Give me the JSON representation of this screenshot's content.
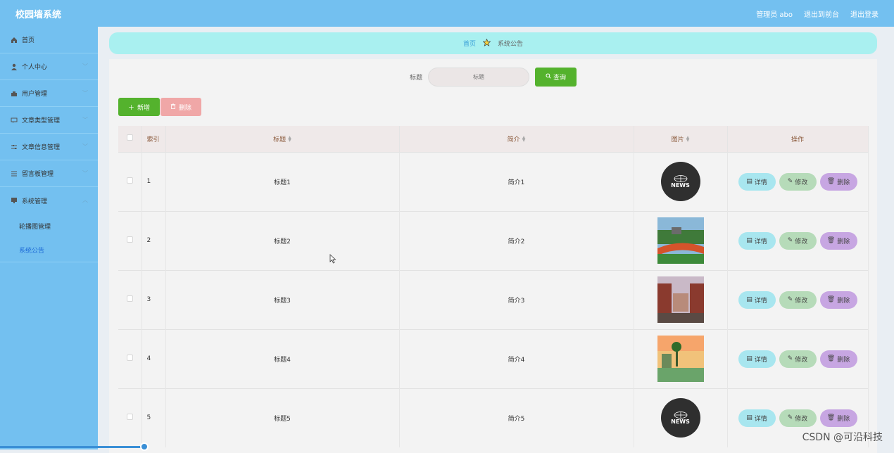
{
  "app": {
    "title": "校园墙系统"
  },
  "top_actions": [
    "管理员 abo",
    "退出到前台",
    "退出登录"
  ],
  "sidebar": {
    "items": [
      {
        "label": "首页",
        "icon": "home-icon",
        "has_children": false
      },
      {
        "label": "个人中心",
        "icon": "user-icon",
        "has_children": true
      },
      {
        "label": "用户管理",
        "icon": "users-icon",
        "has_children": true
      },
      {
        "label": "文章类型管理",
        "icon": "chat-icon",
        "has_children": true
      },
      {
        "label": "文章信息管理",
        "icon": "sliders-icon",
        "has_children": true
      },
      {
        "label": "留言板管理",
        "icon": "list-icon",
        "has_children": true
      },
      {
        "label": "系统管理",
        "icon": "monitor-icon",
        "has_children": true,
        "expanded": true
      }
    ],
    "subitems": [
      {
        "label": "轮播图管理",
        "active": false
      },
      {
        "label": "系统公告",
        "active": true
      }
    ]
  },
  "breadcrumb": {
    "home": "首页",
    "current": "系统公告"
  },
  "search": {
    "label": "标题",
    "placeholder": "标题",
    "button": "查询"
  },
  "toolbar": {
    "add": "新增",
    "delete": "删除"
  },
  "table": {
    "columns": [
      "索引",
      "标题",
      "简介",
      "图片",
      "操作"
    ],
    "rows": [
      {
        "index": "1",
        "title": "标题1",
        "intro": "简介1",
        "image": "news-logo"
      },
      {
        "index": "2",
        "title": "标题2",
        "intro": "简介2",
        "image": "campus-track-photo"
      },
      {
        "index": "3",
        "title": "标题3",
        "intro": "简介3",
        "image": "campus-building-photo"
      },
      {
        "index": "4",
        "title": "标题4",
        "intro": "简介4",
        "image": "campus-sunset-photo"
      },
      {
        "index": "5",
        "title": "标题5",
        "intro": "简介5",
        "image": "news-logo"
      }
    ],
    "row_actions": {
      "detail": "详情",
      "edit": "修改",
      "delete": "删除"
    }
  },
  "news_logo_text": "NEWS",
  "watermark": "CSDN @可沿科技"
}
